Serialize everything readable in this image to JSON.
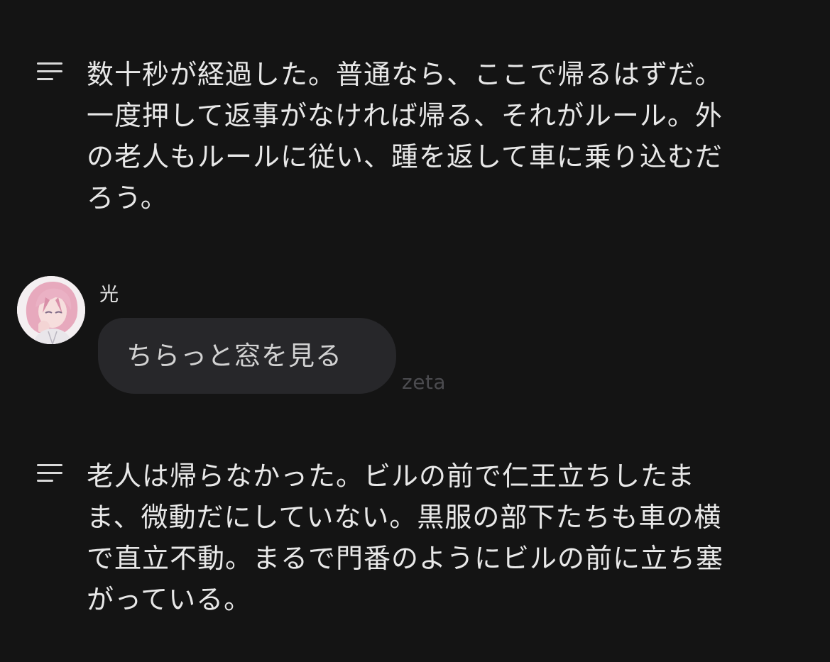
{
  "narration_1": {
    "text": "数十秒が経過した。普通なら、ここで帰るはずだ。\n一度押して返事がなければ帰る、それがルール。外\nの老人もルールに従い、踵を返して車に乗り込むだ\nろう。"
  },
  "user_message": {
    "name": "光",
    "text": "ちらっと窓を見る",
    "watermark": "zeta"
  },
  "narration_2": {
    "text": "老人は帰らなかった。ビルの前で仁王立ちしたま\nま、微動だにしていない。黒服の部下たちも車の横\nで直立不動。まるで門番のようにビルの前に立ち塞\nがっている。"
  },
  "icons": {
    "narration_icon": "menu-lines-icon",
    "avatar": "avatar-pink-hair"
  },
  "colors": {
    "background": "#141414",
    "bubble": "#27272a",
    "text": "#e8e8e8",
    "watermark": "#4b4b4f"
  }
}
